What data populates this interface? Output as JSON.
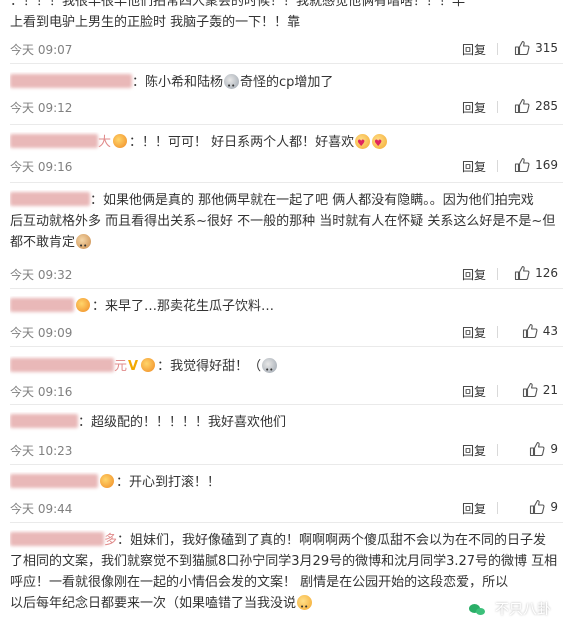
{
  "comments": [
    {
      "lines": [
        "：！！！我很早很早他们拍常四人聚会的时候！！我就感觉他俩有暗啥！！！早",
        "上看到电驴上男生的正脸时 我脑子轰的一下！！靠"
      ],
      "time": "今天 09:07",
      "reply": "回复",
      "likes": "315"
    },
    {
      "username": "陈小希和陆杨",
      "mention": "：陈小希和陆杨",
      "body": "奇怪的cp增加了",
      "time": "今天 09:12",
      "reply": "回复",
      "likes": "285"
    },
    {
      "username": "大",
      "body": "：！！可可！ 好日系两个人都！好喜欢",
      "time": "今天 09:16",
      "reply": "回复",
      "likes": "169"
    },
    {
      "lines": [
        "：如果他俩是真的 那他俩早就在一起了吧 俩人都没有隐瞒。。因为他们拍完戏",
        "后互动就格外多 而且看得出关系~很好 不一般的那种 当时就有人在怀疑 关系这么好是不是~但",
        "都不敢肯定"
      ],
      "time": "今天 09:32",
      "reply": "回复",
      "likes": "126"
    },
    {
      "body": "：来早了…那卖花生瓜子饮料…",
      "time": "今天 09:09",
      "reply": "回复",
      "likes": "43"
    },
    {
      "username": "元",
      "vip": "V",
      "body": "：我觉得好甜！（",
      "time": "今天 09:16",
      "reply": "回复",
      "likes": "21"
    },
    {
      "body": "：超级配的！！！！！我好喜欢他们",
      "time": "今天 10:23",
      "reply": "回复",
      "likes": "9"
    },
    {
      "body": "：开心到打滚！！",
      "time": "今天 09:44",
      "reply": "回复",
      "likes": "9"
    },
    {
      "username": "多",
      "lines": [
        "：姐妹们，我好像磕到了真的！啊啊啊两个傻瓜甜不会以为在不同的日子发",
        "了相同的文案，我们就察觉不到猫腻8口孙宁同学3月29号的微博和沈月同学3.27号的微博 互相",
        "呼应！一看就很像刚在一起的小情侣会发的文案！ 剧情是在公园开始的这段恋爱，所以",
        "以后每年纪念日都要来一次（如果嗑错了当我没说"
      ]
    }
  ],
  "watermark": {
    "text": "不只八卦",
    "icon": "wechat-icon"
  },
  "colors": {
    "username": "#e9b8b8",
    "meta": "#808080",
    "vip": "#f2a900"
  }
}
